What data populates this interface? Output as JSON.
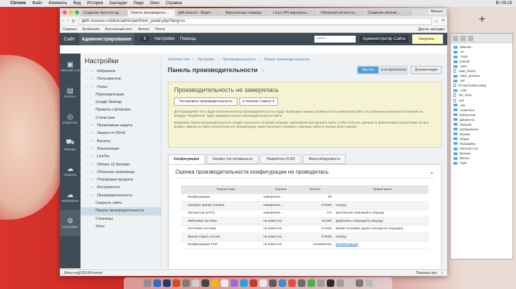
{
  "menubar": {
    "app": "Chrome",
    "items": [
      "Файл",
      "Изменить",
      "Вид",
      "История",
      "Закладки",
      "Люди",
      "Окно",
      "Справка"
    ],
    "clock": "Вт 09:19"
  },
  "browser": {
    "tabs": [
      "Создание простого ад...",
      "Панель производител...",
      "gkth.mosoox - Видео",
      "Виртуальные серверы",
      "Linux VPS виртуальн...",
      "Облачный хостинг за...",
      "Создание нагонки ..."
    ],
    "active_tab": 1,
    "user": "Михаил",
    "url": "gkth.mosoox.ru/bitrix/admin/perfmon_panel.php?lang=ru",
    "bookmarks": [
      "Сервисы",
      "Bookmarks",
      "Бесплатный хост",
      "Фитнес",
      "Почта"
    ],
    "bookmarks_other": "Другие закладки"
  },
  "admin_header": {
    "site_tab": "Сайт",
    "admin_tab": "Администрирование",
    "counter": "6",
    "settings_link": "Настройки",
    "help_link": "Помощь",
    "search_placeholder": "поиск...",
    "user": "Администратор Сайта",
    "loading": "Загрузка..."
  },
  "left_icons": [
    {
      "glyph": "▣",
      "label": "Рабочий стол"
    },
    {
      "glyph": "▤",
      "label": "Контент"
    },
    {
      "glyph": "◎",
      "label": "Маркетинг"
    },
    {
      "glyph": "⛟",
      "label": "Магазин"
    },
    {
      "glyph": "☁",
      "label": "Сервисы"
    },
    {
      "glyph": "☁",
      "label": "Marketplace"
    },
    {
      "glyph": "⚙",
      "label": "Настройки"
    }
  ],
  "menu": {
    "title": "Настройки",
    "items": [
      {
        "label": "Избранное",
        "level": 0
      },
      {
        "label": "Пользователи",
        "level": 0
      },
      {
        "label": "Поиск",
        "level": 0
      },
      {
        "label": "Переиндексация",
        "level": 1
      },
      {
        "label": "Google Sitemap",
        "level": 1
      },
      {
        "label": "Правила сортировки",
        "level": 1
      },
      {
        "label": "Статистика",
        "level": 1
      },
      {
        "label": "Проактивная защита",
        "level": 0
      },
      {
        "label": "Защита от DDoS",
        "level": 0
      },
      {
        "label": "Валюты",
        "level": 0
      },
      {
        "label": "Локализация",
        "level": 0
      },
      {
        "label": "LiveTex",
        "level": 0
      },
      {
        "label": "Облако 1С-Битрикс",
        "level": 0
      },
      {
        "label": "Облачные хранилища",
        "level": 0
      },
      {
        "label": "Платформа продукта",
        "level": 0
      },
      {
        "label": "Инструменты",
        "level": 0
      },
      {
        "label": "Производительность",
        "level": 0
      },
      {
        "label": "Скорость сайта",
        "level": 1
      },
      {
        "label": "Панель производительности",
        "level": 1
      },
      {
        "label": "Страницы",
        "level": 1
      },
      {
        "label": "Хиты",
        "level": 1
      }
    ],
    "selected": 18
  },
  "main": {
    "breadcrumbs": [
      "Рабочий стол",
      "Настройки",
      "Производительность",
      "Панель производительности"
    ],
    "title": "Панель производительности",
    "master_button": "Мастер",
    "radio_label": "не выполнено",
    "docs_button": "Документация",
    "warn": {
      "title": "Производительность не замерялась",
      "test_button": "Тестировать производительность",
      "duration": "в течение 3 минут",
      "text1": "Для проведения теста будет включен монитор производительности и будут проведены замеры активности пользователей сайта. По окончании указанного интервала на вкладке \"Разработка\" будет выведена оценка производительности сайта.",
      "text2": "Внимание! Замер производительности следует выполнять во время нагрузки, характерной для данного сайта, чтобы получить данные по фактическим посетителям. Если в момент замера на сайте посетителей нет, рекомендуем самостоятельно открывать страницы сайта в течение всего замера."
    },
    "tabs": [
      "Конфигурация",
      "Битрикс (не оптимально)",
      "Разработка (0.00)",
      "Масштабируемость"
    ],
    "panel_title": "Оценка производительности конфигурации не проводилась",
    "table": {
      "headers": [
        "Подсистема",
        "Оценка",
        "Эталон",
        "Примечание"
      ],
      "rows": [
        [
          "Конфигурация",
          "измерение...",
          "30",
          ""
        ],
        [
          "Среднее время отклика",
          "измерение...",
          "0.0330",
          "секунд"
        ],
        [
          "Процессор (CPU)",
          "измерение...",
          "0.0",
          "миллионов операций в секунду"
        ],
        [
          "Файловая система",
          "не известно",
          "10.000",
          "файловых операций в секунду"
        ],
        [
          "Почтовая система",
          "не известно",
          "0.0100",
          "время отправки одного письма (в секундах)"
        ],
        [
          "Время старта сессии",
          "не известно",
          "0.0000",
          "секунд"
        ],
        [
          "Конфигурация PHP",
          "не известно",
          "оптимально",
          "рекомендации"
        ]
      ]
    }
  },
  "downloads": {
    "file": "[Ilmaz.org]100159.torrent",
    "show_all": "Показать все"
  },
  "finder": {
    "items": [
      {
        "label": "Заметки...",
        "type": "folder"
      },
      {
        "label": ".1C",
        "type": "folder"
      },
      {
        "label": ".Trash",
        "type": "folder"
      },
      {
        "label": "android",
        "type": "folder"
      },
      {
        "label": ".atom",
        "type": "folder"
      },
      {
        "label": ".bash_history",
        "type": "file"
      },
      {
        "label": ".bash_sessions",
        "type": "folder"
      },
      {
        "label": ".bef",
        "type": "folder"
      },
      {
        "label": "CFUserTextEncoding",
        "type": "file"
      },
      {
        "label": ".cups",
        "type": "folder"
      },
      {
        "label": ".DS_Store",
        "type": "file"
      },
      {
        "label": ".mxl",
        "type": "file"
      },
      {
        "label": ".ssh",
        "type": "folder"
      },
      {
        "label": ".subversion",
        "type": "folder"
      },
      {
        "label": "Библиотеки",
        "type": "folder"
      },
      {
        "label": "Документы",
        "type": "folder"
      },
      {
        "label": "Загрузки",
        "type": "folder"
      },
      {
        "label": "Изображения",
        "type": "folder"
      },
      {
        "label": "Музыка",
        "type": "folder"
      },
      {
        "label": "Общие",
        "type": "folder"
      },
      {
        "label": "Программы",
        "type": "folder"
      },
      {
        "label": "Рабочий стол",
        "type": "folder"
      },
      {
        "label": "Фильмы",
        "type": "folder"
      },
      {
        "label": "Bitrix24",
        "type": "folder"
      },
      {
        "label": "Trash",
        "type": "folder"
      }
    ]
  },
  "dock_colors": [
    "#8e8e8e",
    "#2e6bd8",
    "#1f3b6e",
    "#d54b1e",
    "#7b7b7b",
    "#cfcfcf",
    "#444",
    "#f2b705",
    "#eeeeee",
    "#9a6ad6",
    "#24a1de",
    "#c0392b",
    "#e8e8e8",
    "#5b5b5b",
    "#3b8dd9",
    "#e74c3c",
    "#6d6d6d",
    "#4caf50",
    "#a0a0a0",
    "#2d2d2d",
    "#9e9e9e",
    "#c8c8c8",
    "#7a7a7a",
    "#bbbbbb"
  ]
}
